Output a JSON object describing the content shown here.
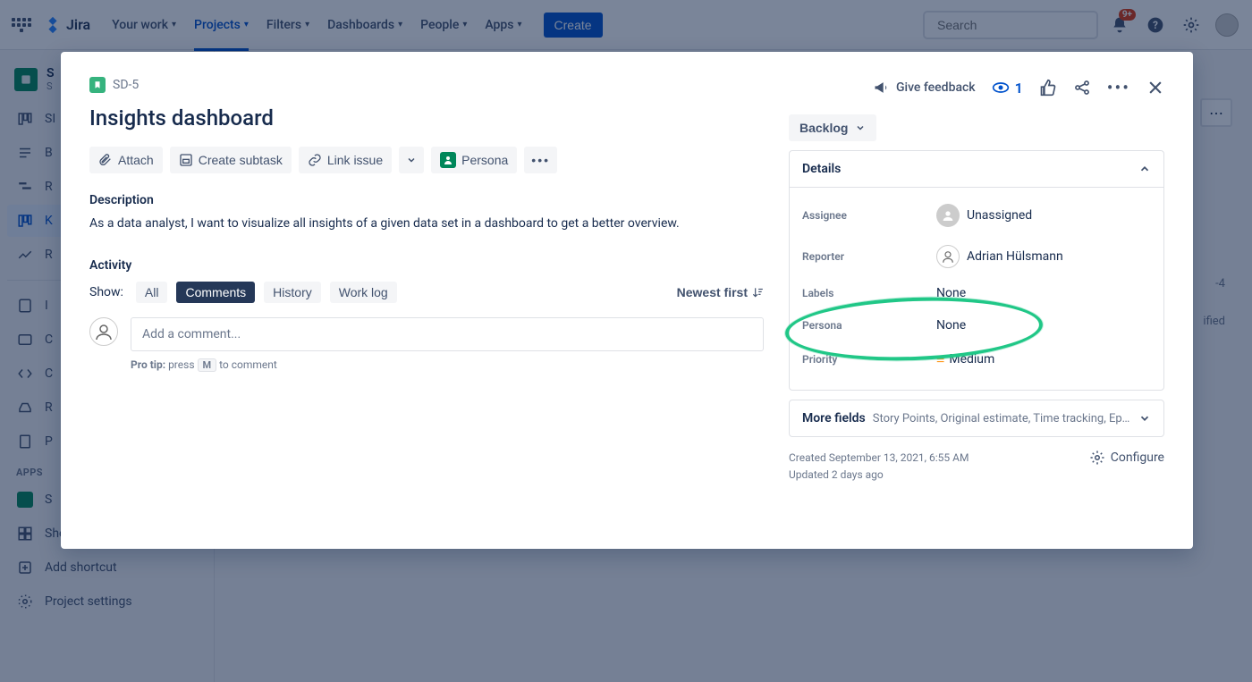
{
  "topnav": {
    "logo": "Jira",
    "items": [
      "Your work",
      "Projects",
      "Filters",
      "Dashboards",
      "People",
      "Apps"
    ],
    "active_index": 1,
    "create": "Create",
    "search_placeholder": "Search",
    "notif_badge": "9+"
  },
  "sidebar": {
    "project_initial": "S",
    "project_sub": "S",
    "items_top": [
      "SI",
      "B",
      "R",
      "K",
      "R"
    ],
    "items_top_active_index": 3,
    "items_mid": [
      "I",
      "C",
      "C",
      "R",
      "P"
    ],
    "apps_heading": "APPS",
    "apps_item": "S",
    "sheets": "Sheets",
    "add_shortcut": "Add shortcut",
    "project_settings": "Project settings"
  },
  "bg": {
    "right_count": "-4",
    "right_text": "ified"
  },
  "modal": {
    "issue_key": "SD-5",
    "title": "Insights dashboard",
    "actions": {
      "attach": "Attach",
      "create_subtask": "Create subtask",
      "link_issue": "Link issue",
      "persona": "Persona"
    },
    "description_label": "Description",
    "description_text": "As a data analyst, I want to visualize all insights of a given data set in a dashboard to get a better overview.",
    "activity_label": "Activity",
    "show_label": "Show:",
    "tabs": [
      "All",
      "Comments",
      "History",
      "Work log"
    ],
    "tabs_active_index": 1,
    "sort_label": "Newest first",
    "comment_placeholder": "Add a comment...",
    "protip_strong": "Pro tip:",
    "protip_before": "press",
    "protip_key": "M",
    "protip_after": "to comment",
    "right": {
      "feedback": "Give feedback",
      "watchers": "1",
      "status": "Backlog",
      "details_label": "Details",
      "fields": {
        "assignee_k": "Assignee",
        "assignee_v": "Unassigned",
        "reporter_k": "Reporter",
        "reporter_v": "Adrian Hülsmann",
        "labels_k": "Labels",
        "labels_v": "None",
        "persona_k": "Persona",
        "persona_v": "None",
        "priority_k": "Priority",
        "priority_v": "Medium"
      },
      "more_fields_label": "More fields",
      "more_fields_sub": "Story Points, Original estimate, Time tracking, Ep…",
      "created": "Created September 13, 2021, 6:55 AM",
      "updated": "Updated 2 days ago",
      "configure": "Configure"
    }
  }
}
